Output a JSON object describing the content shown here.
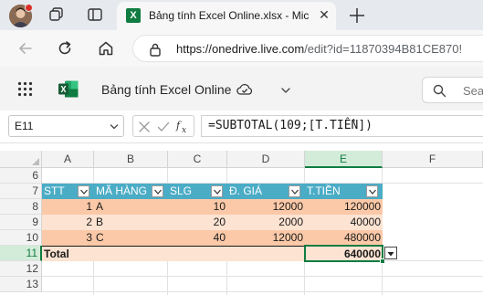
{
  "browser": {
    "tab_title": "Bảng tính Excel Online.xlsx - Micro",
    "tab_close": "✕",
    "url_host": "https://onedrive.live.com",
    "url_path": "/edit?id=11870394B81CE870!"
  },
  "excel": {
    "app_title": "Bảng tính Excel Online",
    "search_placeholder": "Sea",
    "logo_letter": "X"
  },
  "formula_bar": {
    "name_box": "E11",
    "formula": "=SUBTOTAL(109;[T.TIỀN])"
  },
  "grid": {
    "columns": [
      "A",
      "B",
      "C",
      "D",
      "E",
      "F"
    ],
    "selected_column": "E",
    "rows": [
      "6",
      "7",
      "8",
      "9",
      "10",
      "11",
      "12",
      "13"
    ],
    "selected_row": "11",
    "table_headers": [
      "STT",
      "MÃ HÀNG",
      "SLG",
      "Đ. GIÁ",
      "T.TIỀN"
    ],
    "table_rows": [
      {
        "stt": "1",
        "ma_hang": "A",
        "slg": "10",
        "don_gia": "12000",
        "thanh_tien": "120000"
      },
      {
        "stt": "2",
        "ma_hang": "B",
        "slg": "20",
        "don_gia": "2000",
        "thanh_tien": "40000"
      },
      {
        "stt": "3",
        "ma_hang": "C",
        "slg": "40",
        "don_gia": "12000",
        "thanh_tien": "480000"
      }
    ],
    "total_label": "Total",
    "total_value": "640000"
  },
  "colors": {
    "header_fill": "#4bacc6",
    "band_dark": "#fbc9a8",
    "band_light": "#fde3d2",
    "excel_green": "#107c41"
  }
}
